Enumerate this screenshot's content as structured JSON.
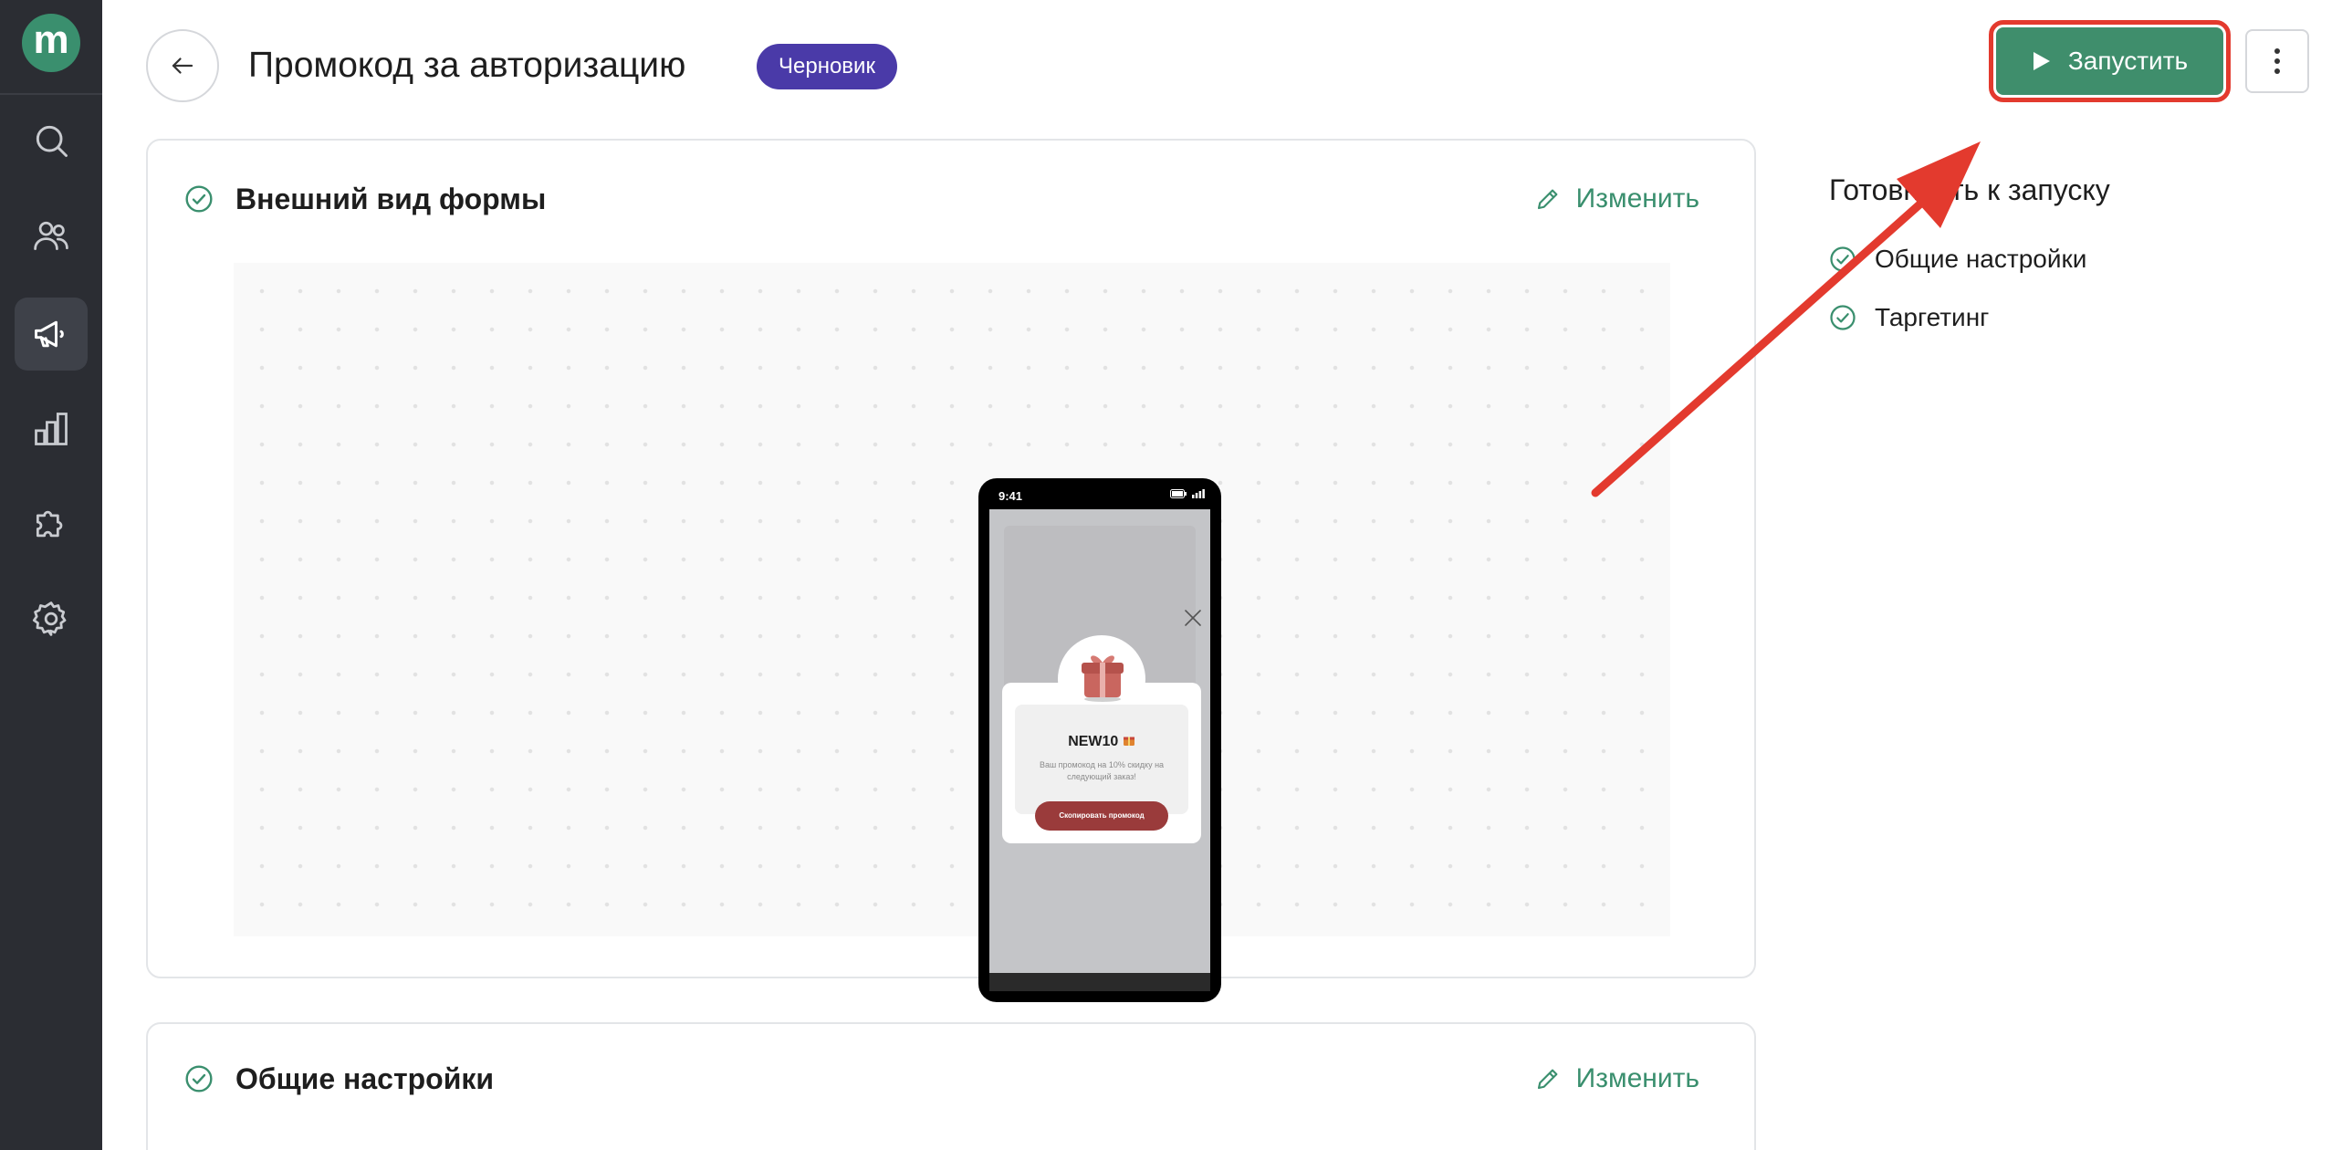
{
  "app": {
    "logo_letter": "m",
    "accent_color": "#3a8f6e",
    "badge_color": "#4a3aa8",
    "highlight_color": "#e33a2e"
  },
  "sidebar": {
    "items": [
      {
        "name": "search",
        "icon": "search-icon"
      },
      {
        "name": "audience",
        "icon": "users-icon"
      },
      {
        "name": "campaigns",
        "icon": "megaphone-icon",
        "active": true
      },
      {
        "name": "analytics",
        "icon": "bar-chart-icon"
      },
      {
        "name": "integrations",
        "icon": "puzzle-icon"
      },
      {
        "name": "settings",
        "icon": "gear-icon"
      }
    ]
  },
  "header": {
    "title": "Промокод за авторизацию",
    "status": "Черновик",
    "launch_label": "Запустить"
  },
  "cards": {
    "appearance": {
      "title": "Внешний вид формы",
      "edit_label": "Изменить"
    },
    "general": {
      "title": "Общие настройки",
      "edit_label": "Изменить"
    }
  },
  "preview": {
    "time": "9:41",
    "promo_code": "NEW10",
    "description": "Ваш промокод на 10% скидку на следующий заказ!",
    "copy_button": "Скопировать промокод"
  },
  "readiness": {
    "title": "Готовность к запуску",
    "items": [
      "Общие настройки",
      "Таргетинг"
    ]
  }
}
